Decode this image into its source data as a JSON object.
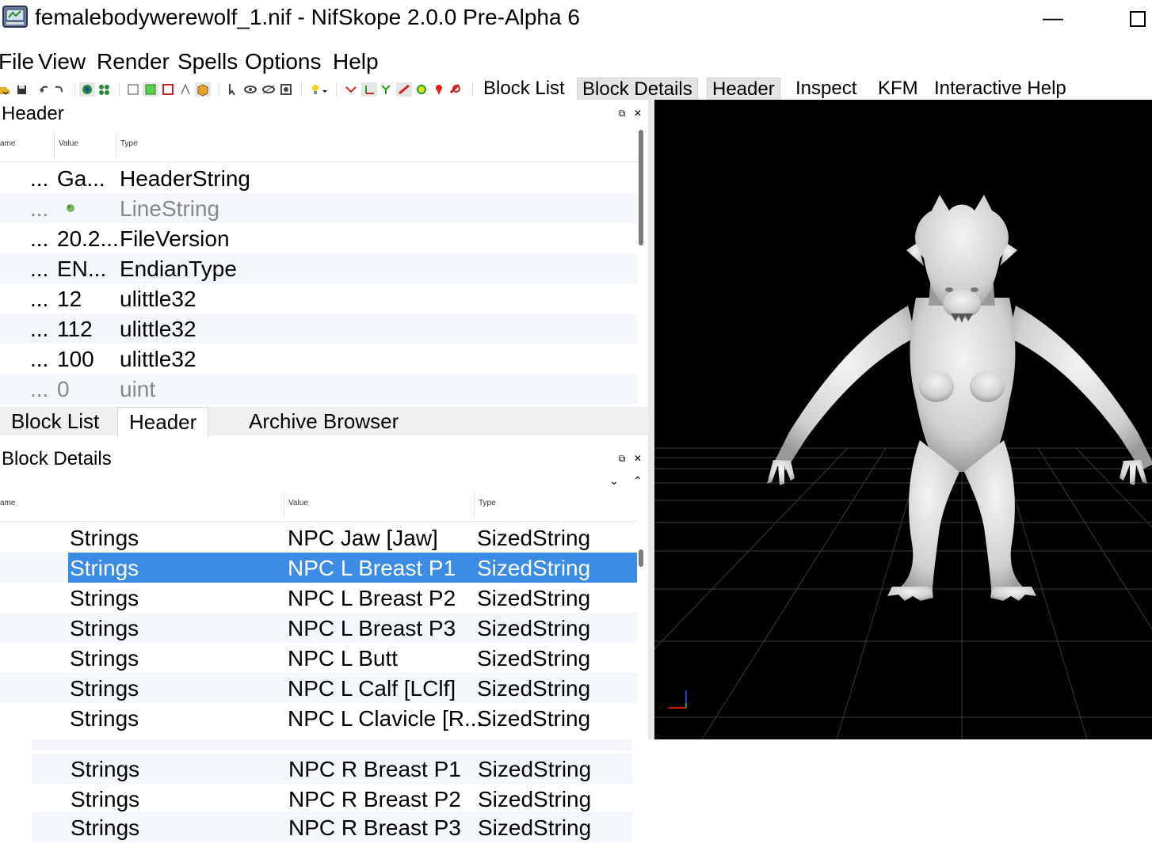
{
  "window": {
    "title": "femalebodywerewolf_1.nif - NifSkope 2.0.0 Pre-Alpha 6",
    "minimize_glyph": "—"
  },
  "menu": [
    "File",
    "View",
    "Render",
    "Spells",
    "Options",
    "Help"
  ],
  "toolbar": {
    "icons": [
      "open-icon",
      "save-icon",
      "undo-icon",
      "redo-icon",
      "select-icon",
      "flag-icon",
      "window-icon",
      "square-icon",
      "cube-red-icon",
      "cube-icon",
      "box-icon",
      "pointer-icon",
      "eye-icon",
      "eye2-icon",
      "screenshot-icon",
      "bulb-icon",
      "axes-icon",
      "xy-axes-icon",
      "node-icon",
      "light-icon",
      "marker-icon",
      "pin-icon",
      "eraser-icon"
    ],
    "dock_toggles": [
      "Block List",
      "Block Details",
      "Header",
      "Inspect",
      "KFM",
      "Interactive Help"
    ]
  },
  "header_dock": {
    "title": "Header",
    "columns": [
      "ame",
      "Value",
      "Type"
    ],
    "rows": [
      {
        "name": "...",
        "value": "Ga...",
        "type": "HeaderString",
        "dim": false
      },
      {
        "name": "...",
        "value": "",
        "type": "LineString",
        "dim": true
      },
      {
        "name": "...",
        "value": "20.2...",
        "type": "FileVersion",
        "dim": false
      },
      {
        "name": "...",
        "value": "EN...",
        "type": "EndianType",
        "dim": false
      },
      {
        "name": "...",
        "value": "12",
        "type": "ulittle32",
        "dim": false
      },
      {
        "name": "...",
        "value": "112",
        "type": "ulittle32",
        "dim": false
      },
      {
        "name": "...",
        "value": "100",
        "type": "ulittle32",
        "dim": false
      },
      {
        "name": "...",
        "value": "0",
        "type": "uint",
        "dim": true
      }
    ]
  },
  "tabs": [
    {
      "label": "Block List",
      "active": false
    },
    {
      "label": "Header",
      "active": true
    },
    {
      "label": "Archive Browser",
      "active": false
    }
  ],
  "details_dock": {
    "title": "Block Details",
    "columns": [
      "ame",
      "Value",
      "Type"
    ],
    "rows": [
      {
        "name": "Strings",
        "value": "NPC Jaw [Jaw]",
        "type": "SizedString",
        "selected": false
      },
      {
        "name": "Strings",
        "value": "NPC L Breast P1",
        "type": "SizedString",
        "selected": true
      },
      {
        "name": "Strings",
        "value": "NPC L Breast P2",
        "type": "SizedString",
        "selected": false
      },
      {
        "name": "Strings",
        "value": "NPC L Breast P3",
        "type": "SizedString",
        "selected": false
      },
      {
        "name": "Strings",
        "value": "NPC L Butt",
        "type": "SizedString",
        "selected": false
      },
      {
        "name": "Strings",
        "value": "NPC L Calf [LClf]",
        "type": "SizedString",
        "selected": false
      },
      {
        "name": "Strings",
        "value": "NPC L Clavicle [R...",
        "type": "SizedString",
        "selected": false
      }
    ],
    "overflow_rows": [
      {
        "name": "Strings",
        "value": "NPC R Breast P1",
        "type": "SizedString"
      },
      {
        "name": "Strings",
        "value": "NPC R Breast P2",
        "type": "SizedString"
      },
      {
        "name": "Strings",
        "value": "NPC R Breast P3",
        "type": "SizedString"
      }
    ]
  },
  "colors": {
    "selection": "#3c8ce6",
    "viewport_bg": "#000000",
    "row_alt": "#f3f6fa",
    "grid": "#3a3a3a"
  }
}
